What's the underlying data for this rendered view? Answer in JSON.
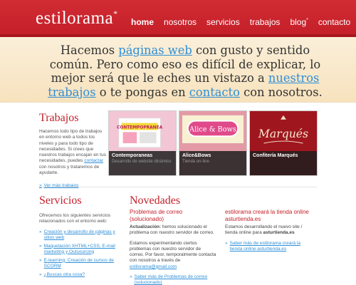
{
  "header": {
    "logo": "estilorama",
    "logo_mark": "*",
    "nav": [
      {
        "label": "home",
        "active": true
      },
      {
        "label": "nosotros",
        "active": false
      },
      {
        "label": "servicios",
        "active": false
      },
      {
        "label": "trabajos",
        "active": false
      },
      {
        "label": "blog",
        "sup": "*",
        "active": false
      },
      {
        "label": "contacto",
        "active": false
      }
    ]
  },
  "hero": {
    "t1": "Hacemos ",
    "link1": "páginas web",
    "t2": " con gusto y sentido común. Pero como eso es difícil de explicar, lo mejor será que le eches un vistazo a ",
    "link2": "nuestros trabajos",
    "t3": " o te pongas en ",
    "link3": "contacto",
    "t4": " con nosotros."
  },
  "trabajos": {
    "title": "Trabajos",
    "text1": "Hacemos todo tipo de trabajos en entorno web a todos los niveles y para todo tipo de necesidades. Si crees que nuestros trabajos encajan en tus necesidades, puedes ",
    "link": "contactar",
    "text2": " con nosotros y trataremos de ayudarte.",
    "more": "Ver más trabajos",
    "items": [
      {
        "title": "Contemporaneas",
        "subtitle": "Desarrollo de website dinámico",
        "art": "CONTEMPOPRANEA"
      },
      {
        "title": "Alice&Bows",
        "subtitle": "Tienda on-line",
        "art": "Alice & Bows"
      },
      {
        "title": "Confitería Marqués",
        "subtitle": "",
        "art": "Marqués"
      }
    ]
  },
  "servicios": {
    "title": "Servicios",
    "intro": "Ofrecemos los siguientes servicios relacionados con el entorno web:",
    "items": [
      "Creación y desarrollo de páginas y sitios web",
      "Maquetación XHTML+CSS, E-mail marketing y Outsourcing",
      "E-learning: Creación de cursos de SCORM",
      "¿Buscas otra cosa?"
    ]
  },
  "novedades": {
    "title": "Novedades",
    "news": [
      {
        "title": "Problemas de correo (solucionado)",
        "p1_bold": "Actualización:",
        "p1": " hemos solucionado el problema con nuestro servidor de correo.",
        "p2": "Estamos experimentando ciertos problemas con nuestro servidor de correo. Por favor, temporalmente contacta con nosotros a través de ",
        "email": "estilorama@gmail.com",
        "more": "Saber más de Problemas de correo (solucionado)"
      },
      {
        "title": "estilorama creará la tienda online asturtienda.es",
        "p1": "Estamos desarrollando el nuevo site / tienda online para ",
        "p1_bold": "asturtienda.es",
        "more": "Saber más de estilorama creará la tienda online asturtienda.es"
      }
    ]
  },
  "colors": {
    "brand_red": "#c41f28",
    "link_blue": "#2e8fd8",
    "hero_bg": "#f7e2bd"
  },
  "icons": {
    "bullet": "arrow-right-icon"
  }
}
